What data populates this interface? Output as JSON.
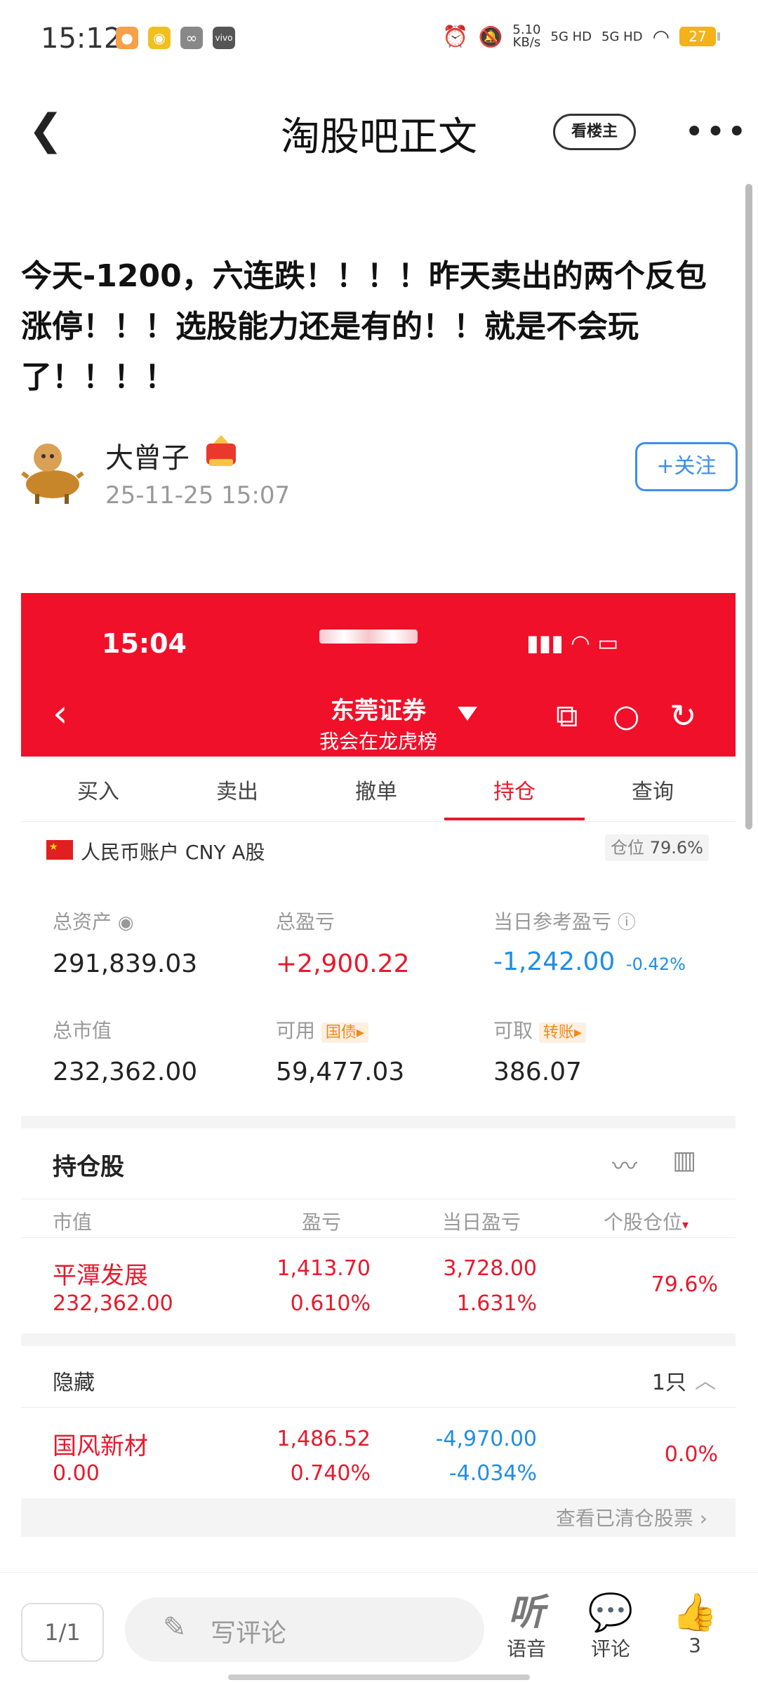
{
  "status_bar": {
    "time": "15:12",
    "net_speed": "5.10\nKB/s",
    "sim1": "5G HD",
    "sim2": "5G HD",
    "battery": "27"
  },
  "nav": {
    "title": "淘股吧正文",
    "louzhu_label": "看楼主"
  },
  "post": {
    "title": "今天-1200，六连跌！！！！昨天卖出的两个反包涨停！！！选股能力还是有的！！就是不会玩了！！！！",
    "author": "大曾子",
    "date": "25-11-25 15:07",
    "follow_label": "+关注"
  },
  "broker": {
    "time": "15:04",
    "title": "东莞证券",
    "subtitle": "我会在龙虎榜",
    "tabs": [
      "买入",
      "卖出",
      "撤单",
      "持仓",
      "查询"
    ],
    "active_tab": "持仓",
    "account": "人民币账户 CNY A股",
    "position_label": "仓位",
    "position_value": "79.6%",
    "stats": {
      "total_assets_label": "总资产",
      "total_assets": "291,839.03",
      "total_pl_label": "总盈亏",
      "total_pl": "+2,900.22",
      "today_pl_label": "当日参考盈亏",
      "today_pl": "-1,242.00",
      "today_pl_pct": "-0.42%",
      "market_value_label": "总市值",
      "market_value": "232,362.00",
      "available_label": "可用",
      "available_tag": "国债▸",
      "available": "59,477.03",
      "withdrawable_label": "可取",
      "withdrawable_tag": "转账▸",
      "withdrawable": "386.07"
    },
    "holdings": {
      "title": "持仓股",
      "headers": [
        "市值",
        "盈亏",
        "当日盈亏",
        "个股仓位"
      ],
      "rows": [
        {
          "name": "平潭发展",
          "market_value": "232,362.00",
          "pl": "1,413.70",
          "pl_pct": "0.610%",
          "day_pl": "3,728.00",
          "day_pl_pct": "1.631%",
          "weight": "79.6%"
        }
      ]
    },
    "hidden": {
      "title": "隐藏",
      "count": "1只",
      "rows": [
        {
          "name": "国风新材",
          "market_value": "0.00",
          "pl": "1,486.52",
          "pl_pct": "0.740%",
          "day_pl": "-4,970.00",
          "day_pl_pct": "-4.034%",
          "weight": "0.0%"
        }
      ]
    },
    "cleared_link": "查看已清仓股票"
  },
  "bottom": {
    "pager": "1/1",
    "comment_placeholder": "写评论",
    "listen_label": "语音",
    "comment_label": "评论",
    "like_count": "3"
  },
  "colors": {
    "accent_red": "#e8192c",
    "blue": "#1f8ee5",
    "follow_blue": "#3b8ef0"
  }
}
